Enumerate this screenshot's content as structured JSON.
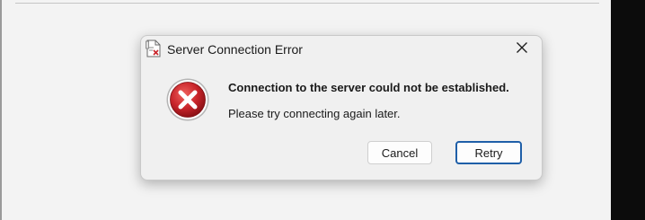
{
  "dialog": {
    "title": "Server Connection Error",
    "app_icon": "document-icon",
    "close_icon": "close-icon",
    "error_icon": "error-x-circle-icon",
    "message_main": "Connection to the server could not be established.",
    "message_sub": "Please try connecting again later.",
    "cancel_label": "Cancel",
    "retry_label": "Retry",
    "default_button": "retry"
  },
  "colors": {
    "error_red": "#c8242a",
    "default_button_border": "#1f5fa8"
  }
}
